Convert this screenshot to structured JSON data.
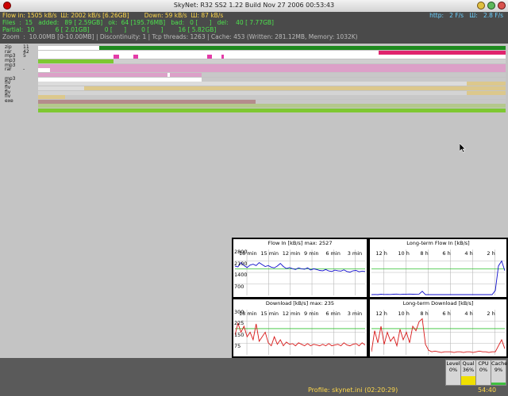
{
  "titlebar": {
    "title": "SkyNet: R32 SS2 1.22    Build  Nov 27 2006  00:53:43"
  },
  "stats": {
    "line1": "Flow in: 1505 kB/s  Ш: 2002 kB/s [6.26GB]        Down: 59 kB/s  Ш: 87 kB/s",
    "line1_right": "http:   2 F/s   Ш:   2.8 F/s",
    "line2": "Files  :  15   added:   89 [ 2.59GB]   ok:  64 [195.76MB]   bad:   0 [      ]   del:    40 [ 7.77GB]",
    "line3": "Partial:  10           6 [ 2.01GB]        0 [      ]        0 [      ]        16 [ 5.82GB]",
    "line4": "Zoom  :  10.00MB [0-10.00MB] | Discontinuity: 1 | Tcp threads: 1263 | Cache: 453 (Written: 281.12MB, Memory: 1032K)"
  },
  "downloads": [
    {
      "type": "zip",
      "count": "11",
      "segs": [
        [
          0.03,
          0.17,
          "#ffffff"
        ],
        [
          0.17,
          1.0,
          "#1e8a1e"
        ]
      ]
    },
    {
      "type": "rar",
      "count": "42",
      "segs": [
        [
          0.03,
          0.74,
          "#ffffff"
        ],
        [
          0.74,
          1.0,
          "#e0246e"
        ]
      ]
    },
    {
      "type": "mp3",
      "count": "5",
      "segs": [
        [
          0.03,
          1.0,
          "#ffffff"
        ],
        [
          0.2,
          0.21,
          "#e43ca8"
        ],
        [
          0.24,
          0.25,
          "#e43ca8"
        ],
        [
          0.39,
          0.4,
          "#e43ca8"
        ],
        [
          0.42,
          0.425,
          "#e43ca8"
        ]
      ]
    },
    {
      "type": "mp3",
      "count": "",
      "segs": [
        [
          0.03,
          0.2,
          "#7ec832"
        ],
        [
          0.2,
          1.0,
          "#cfcfcf"
        ]
      ]
    },
    {
      "type": "mp3",
      "count": "",
      "segs": [
        [
          0.03,
          1.0,
          "#dca0c8"
        ]
      ]
    },
    {
      "type": "rar",
      "count": "-",
      "segs": [
        [
          0.03,
          0.07,
          "#ffffff"
        ],
        [
          0.07,
          1.0,
          "#dca0c8"
        ]
      ]
    },
    {
      "type": "",
      "count": "",
      "segs": [
        [
          0.03,
          0.31,
          "#dca0c8"
        ],
        [
          0.31,
          0.315,
          "#ffffff"
        ],
        [
          0.315,
          0.38,
          "#dca0c8"
        ],
        [
          0.38,
          1.0,
          "#c8c8c8"
        ]
      ]
    },
    {
      "type": "mp3",
      "count": "",
      "segs": [
        [
          0.03,
          0.38,
          "#ffffff"
        ],
        [
          0.38,
          1.0,
          "#c8c8c8"
        ]
      ]
    },
    {
      "type": "flv",
      "count": "",
      "segs": [
        [
          0.03,
          0.92,
          "#dcdcdc"
        ],
        [
          0.92,
          1.0,
          "#dcc88c"
        ]
      ]
    },
    {
      "type": "flv",
      "count": "",
      "segs": [
        [
          0.03,
          0.14,
          "#dcdcdc"
        ],
        [
          0.14,
          1.0,
          "#dcc88c"
        ]
      ]
    },
    {
      "type": "flv",
      "count": "",
      "segs": [
        [
          0.03,
          0.92,
          "#d4d4d4"
        ],
        [
          0.92,
          1.0,
          "#dcc88c"
        ]
      ]
    },
    {
      "type": "flv",
      "count": "",
      "segs": [
        [
          0.03,
          0.1,
          "#dcc88c"
        ],
        [
          0.1,
          1.0,
          "#c8c8c8"
        ]
      ]
    },
    {
      "type": "exe",
      "count": "",
      "segs": [
        [
          0.03,
          0.49,
          "#b48c8c"
        ],
        [
          0.49,
          1.0,
          "#c8c8c8"
        ]
      ]
    },
    {
      "type": "",
      "count": "",
      "segs": [
        [
          0.03,
          1.0,
          "#b4c88c"
        ]
      ]
    },
    {
      "type": "",
      "count": "",
      "segs": [
        [
          0.03,
          1.0,
          "#7ec832"
        ]
      ]
    }
  ],
  "graphs": {
    "flow_in": {
      "title": "Flow In [kB/s]  max: 2527",
      "xticks": [
        "18 min",
        "15 min",
        "12 min",
        "9 min",
        "6 min",
        "3 min"
      ],
      "yticks": [
        "2800",
        "2100",
        "1400",
        "700"
      ],
      "series_color": "#1010cc",
      "values": [
        1780,
        1740,
        2010,
        1820,
        1700,
        1850,
        1900,
        1820,
        2000,
        1880,
        1760,
        1820,
        1720,
        1680,
        1790,
        1950,
        1760,
        1640,
        1700,
        1630,
        1580,
        1680,
        1620,
        1600,
        1680,
        1550,
        1620,
        1580,
        1520,
        1500,
        1580,
        1490,
        1460,
        1540,
        1500,
        1480,
        1560,
        1460,
        1420,
        1500,
        1520,
        1440,
        1480,
        1460
      ]
    },
    "flow_in_lt": {
      "title": "Long-term Flow In [kB/s]",
      "xticks": [
        "12 h",
        "10 h",
        "8 h",
        "6 h",
        "4 h",
        "2 h"
      ],
      "yticks": [],
      "series_color": "#1010cc",
      "values": [
        0,
        60,
        50,
        70,
        60,
        65,
        60,
        70,
        80,
        60,
        70,
        75,
        80,
        70,
        75,
        80,
        250,
        0,
        0,
        0,
        0,
        0,
        0,
        0,
        0,
        0,
        0,
        0,
        0,
        0,
        0,
        0,
        0,
        0,
        0,
        0,
        0,
        0,
        0,
        300,
        1800,
        2100,
        1500
      ]
    },
    "download": {
      "title": "Download [kB/s]  max: 235",
      "xticks": [
        "18 min",
        "15 min",
        "12 min",
        "9 min",
        "6 min",
        "3 min"
      ],
      "yticks": [
        "300",
        "225",
        "150",
        "75"
      ],
      "series_color": "#d81818",
      "values": [
        130,
        210,
        150,
        190,
        120,
        150,
        100,
        205,
        90,
        120,
        150,
        80,
        60,
        120,
        70,
        100,
        60,
        85,
        70,
        75,
        60,
        80,
        70,
        60,
        75,
        60,
        70,
        65,
        60,
        70,
        60,
        75,
        60,
        65,
        70,
        60,
        80,
        65,
        60,
        70,
        75,
        60,
        80,
        65
      ]
    },
    "download_lt": {
      "title": "Long-term Download [kB/s]",
      "xticks": [
        "12 h",
        "10 h",
        "8 h",
        "6 h",
        "4 h",
        "2 h"
      ],
      "yticks": [],
      "series_color": "#d81818",
      "values": [
        20,
        160,
        80,
        190,
        70,
        150,
        90,
        120,
        60,
        170,
        100,
        150,
        80,
        190,
        160,
        220,
        240,
        70,
        30,
        20,
        25,
        20,
        15,
        20,
        20,
        20,
        15,
        20,
        20,
        15,
        20,
        20,
        15,
        20,
        25,
        20,
        20,
        15,
        20,
        20,
        60,
        100,
        40
      ]
    }
  },
  "meters": [
    {
      "label": "Level",
      "value": "0%",
      "fill": 0.0,
      "color": "#f0e000"
    },
    {
      "label": "Qual",
      "value": "36%",
      "fill": 0.36,
      "color": "#f0e000"
    },
    {
      "label": "CPU",
      "value": "0%",
      "fill": 0.0,
      "color": "#40c040"
    },
    {
      "label": "Cache",
      "value": "9%",
      "fill": 0.09,
      "color": "#40c040"
    }
  ],
  "footer": {
    "profile": "Profile: skynet.ini (02:20:29)",
    "clock": "54:40"
  }
}
